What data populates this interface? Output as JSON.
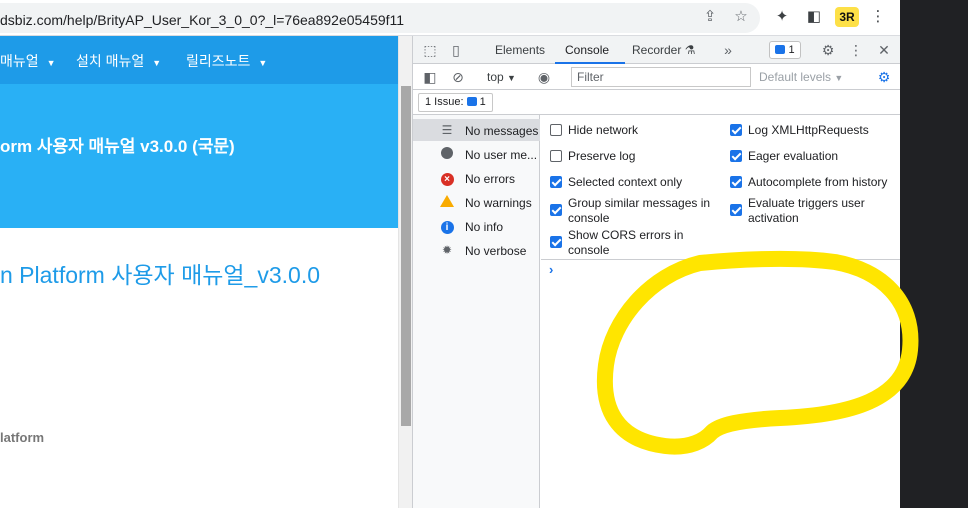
{
  "browser": {
    "url": "dsbiz.com/help/BrityAP_User_Kor_3_0_0?_l=76ea892e05459f11",
    "icons": [
      "share-icon",
      "star-icon",
      "puzzle-icon",
      "sidepanel-icon",
      "kebab-icon"
    ],
    "extension_badge": "3R"
  },
  "page": {
    "nav": [
      {
        "label": "매뉴얼"
      },
      {
        "label": "설치 매뉴얼"
      },
      {
        "label": "릴리즈노트"
      }
    ],
    "hero_title": "orm 사용자 매뉴얼 v3.0.0 (국문)",
    "content_title": "n Platform 사용자 매뉴얼_v3.0.0",
    "side_label": "latform"
  },
  "devtools": {
    "tabs": [
      {
        "label": "Elements",
        "active": false
      },
      {
        "label": "Console",
        "active": true
      },
      {
        "label": "Recorder",
        "active": false
      }
    ],
    "issues_count": "1",
    "context": "top",
    "filter_placeholder": "Filter",
    "levels": "Default levels",
    "issue_chip": "1 Issue:",
    "issue_chip_count": "1",
    "sidebar": [
      {
        "label": "No messages",
        "icon": "list-icon"
      },
      {
        "label": "No user me...",
        "icon": "user-icon"
      },
      {
        "label": "No errors",
        "icon": "error-icon"
      },
      {
        "label": "No warnings",
        "icon": "warning-icon"
      },
      {
        "label": "No info",
        "icon": "info-icon"
      },
      {
        "label": "No verbose",
        "icon": "verbose-icon"
      }
    ],
    "settings_left": [
      {
        "label": "Hide network",
        "checked": false
      },
      {
        "label": "Preserve log",
        "checked": false
      },
      {
        "label": "Selected context only",
        "checked": true
      },
      {
        "label": "Group similar messages in console",
        "checked": true
      },
      {
        "label": "Show CORS errors in console",
        "checked": true
      }
    ],
    "settings_right": [
      {
        "label": "Log XMLHttpRequests",
        "checked": true
      },
      {
        "label": "Eager evaluation",
        "checked": true
      },
      {
        "label": "Autocomplete from history",
        "checked": true
      },
      {
        "label": "Evaluate triggers user activation",
        "checked": true
      }
    ],
    "prompt": "›"
  },
  "colors": {
    "nav_blue": "#1e9be8",
    "hero_blue": "#29b0f5",
    "accent": "#1a73e8",
    "annotation": "#ffe500"
  }
}
